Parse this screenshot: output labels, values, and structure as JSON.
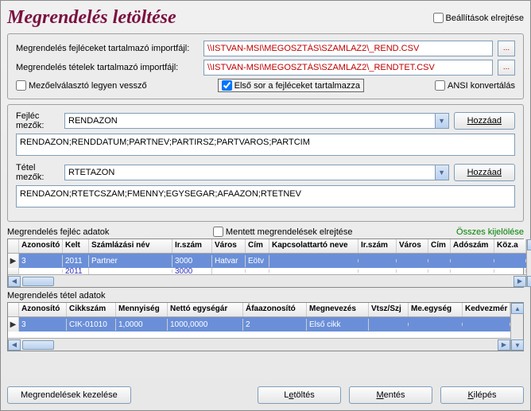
{
  "title": "Megrendelés letöltése",
  "hide_settings_label": "Beállítások elrejtése",
  "file_block": {
    "header_label": "Megrendelés fejléceket tartalmazó importfájl:",
    "header_path": "\\\\ISTVAN-MSI\\MEGOSZTÁS\\SZAMLAZ2\\_REND.CSV",
    "items_label": "Megrendelés tételek tartalmazó importfájl:",
    "items_path": "\\\\ISTVAN-MSI\\MEGOSZTÁS\\SZAMLAZ2\\_RENDTET.CSV",
    "browse": "...",
    "opt_fieldsep": "Mezőelválasztó legyen vessző",
    "opt_firstrow": "Első sor a fejléceket tartalmazza",
    "opt_ansi": "ANSI konvertálás"
  },
  "fields": {
    "header_lbl": "Fejléc mezők:",
    "header_combo": "RENDAZON",
    "header_list": "RENDAZON;RENDDATUM;PARTNEV;PARTIRSZ;PARTVAROS;PARTCIM",
    "item_lbl": "Tétel mezők:",
    "item_combo": "RTETAZON",
    "item_list": "RENDAZON;RTETCSZAM;FMENNY;EGYSEGAR;AFAAZON;RTETNEV",
    "add_btn": "Hozzáad"
  },
  "grid1": {
    "title": "Megrendelés fejléc adatok",
    "hide_saved": "Mentett megrendelések elrejtése",
    "select_all": "Összes kijelölése",
    "cols": {
      "az": "Azonosító",
      "kelt": "Kelt",
      "nev": "Számlázási név",
      "ir": "Ir.szám",
      "var": "Város",
      "cim": "Cím",
      "kap": "Kapcsolattartó neve",
      "ir2": "Ir.szám",
      "var2": "Város",
      "cim2": "Cím",
      "ado": "Adószám",
      "koz": "Köz.a"
    },
    "row1": {
      "az": "3",
      "kelt": "2011",
      "nev": "Partner",
      "ir": "3000",
      "var": "Hatvar",
      "cim": "Eötv"
    },
    "row2": {
      "az": "",
      "kelt": "2011",
      "nev": "",
      "ir": "3000",
      "var": "",
      "cim": ""
    }
  },
  "grid2": {
    "title": "Megrendelés tétel adatok",
    "cols": {
      "az": "Azonosító",
      "cik": "Cikkszám",
      "men": "Mennyiség",
      "net": "Nettó egységár",
      "afa": "Áfaazonosító",
      "meg": "Megnevezés",
      "vt": "Vtsz/Szj",
      "me": "Me.egység",
      "ked": "Kedvezmér"
    },
    "row1": {
      "az": "3",
      "cik": "CIK-01010",
      "men": "1,0000",
      "net": "1000,0000",
      "afa": "2",
      "meg": "Első cikk"
    }
  },
  "footer": {
    "manage": "Megrendelések kezelése",
    "download_pre": "L",
    "download_ul": "e",
    "download_post": "töltés",
    "save_pre": "",
    "save_ul": "M",
    "save_post": "entés",
    "exit_pre": "",
    "exit_ul": "K",
    "exit_post": "ilépés"
  }
}
